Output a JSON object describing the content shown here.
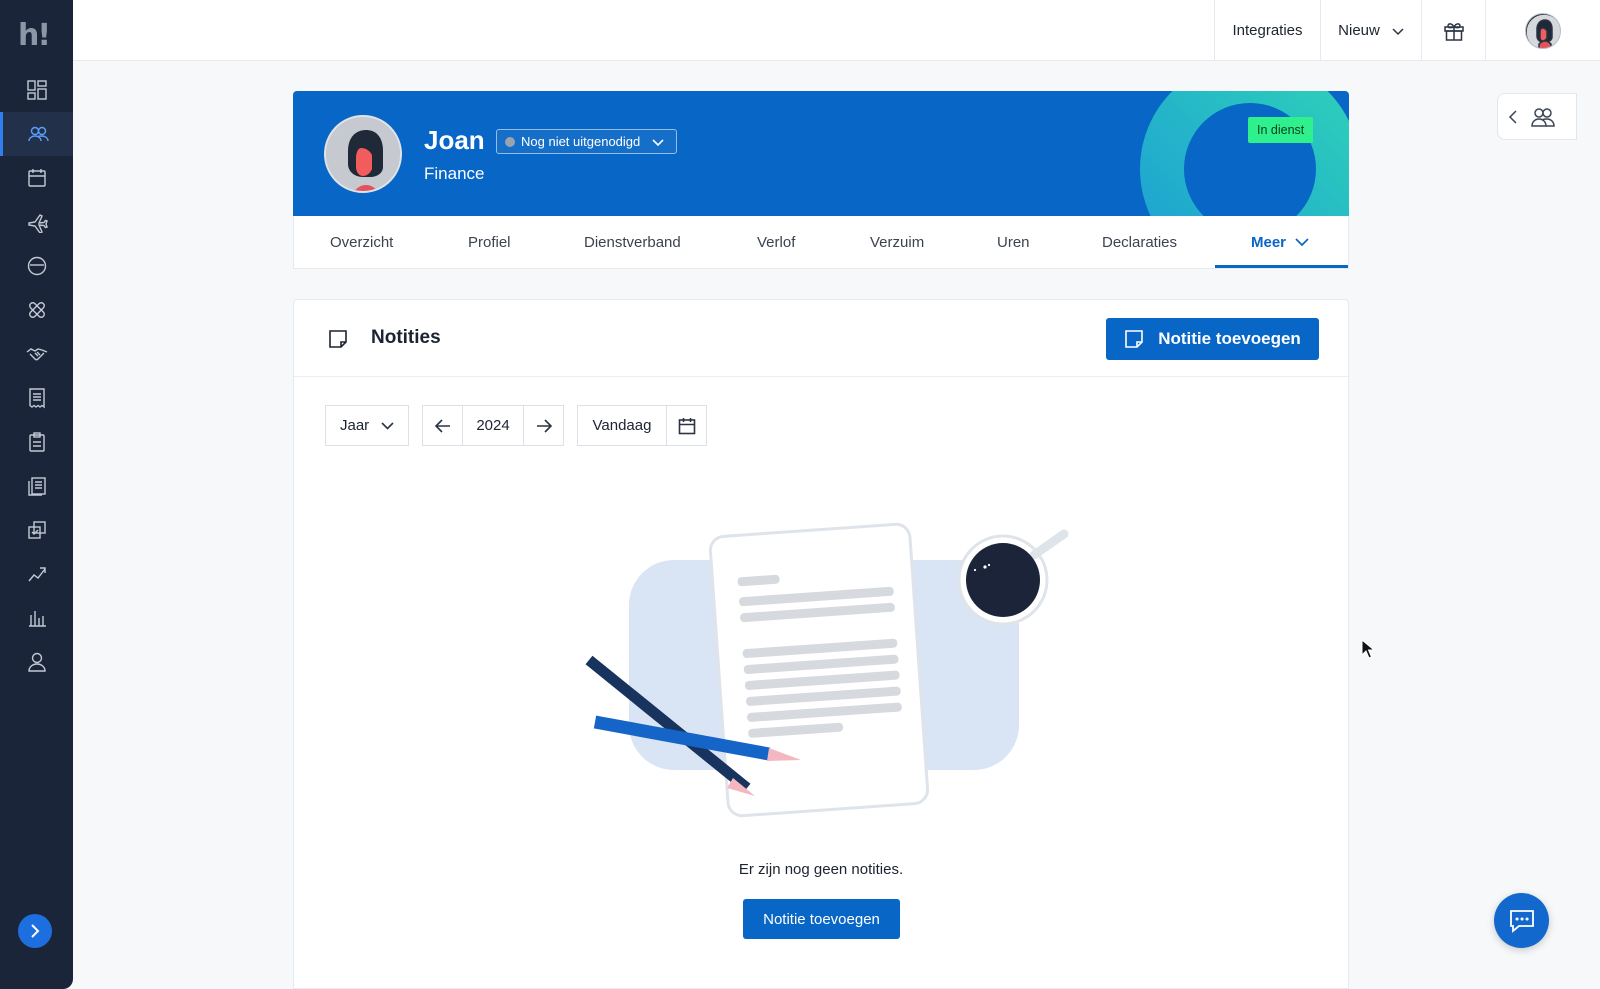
{
  "sidebar": {
    "logo": "h!",
    "items": [
      {
        "icon": "dashboard-icon"
      },
      {
        "icon": "people-icon",
        "active": true
      },
      {
        "icon": "calendar-icon"
      },
      {
        "icon": "plane-icon"
      },
      {
        "icon": "clock-icon"
      },
      {
        "icon": "bandage-icon"
      },
      {
        "icon": "handshake-icon"
      },
      {
        "icon": "receipt-icon"
      },
      {
        "icon": "clipboard-icon"
      },
      {
        "icon": "documents-icon"
      },
      {
        "icon": "checklist-icon"
      },
      {
        "icon": "growth-icon"
      },
      {
        "icon": "bar-chart-icon"
      },
      {
        "icon": "user-icon"
      }
    ]
  },
  "topbar": {
    "integrations": "Integraties",
    "new": "Nieuw"
  },
  "employee": {
    "name": "Joan",
    "department": "Finance",
    "invite_status": "Nog niet uitgenodigd",
    "employment_status": "In dienst"
  },
  "tabs": [
    {
      "label": "Overzicht"
    },
    {
      "label": "Profiel"
    },
    {
      "label": "Dienstverband"
    },
    {
      "label": "Verlof"
    },
    {
      "label": "Verzuim"
    },
    {
      "label": "Uren"
    },
    {
      "label": "Declaraties"
    },
    {
      "label": "Meer",
      "active": true
    }
  ],
  "notes": {
    "title": "Notities",
    "add_button": "Notitie toevoegen",
    "period_select": "Jaar",
    "year": "2024",
    "today": "Vandaag",
    "empty_message": "Er zijn nog geen notities.",
    "empty_add_button": "Notitie toevoegen"
  },
  "colors": {
    "brand": "#0766c6",
    "sidebar": "#1a2539",
    "status_badge": "#2ef08c"
  }
}
